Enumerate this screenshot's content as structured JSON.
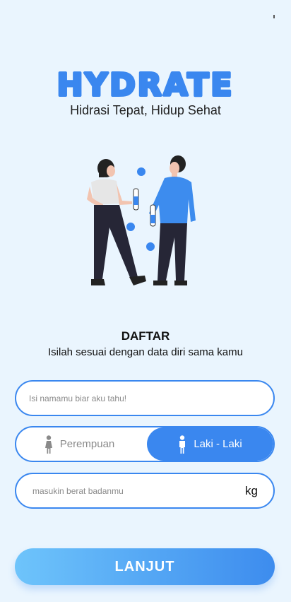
{
  "brand": {
    "logo_text": "HYDRATE",
    "tagline": "Hidrasi Tepat, Hidup Sehat"
  },
  "form": {
    "title": "DAFTAR",
    "subtitle": "Isilah sesuai dengan data diri sama kamu",
    "name_placeholder": "Isi namamu biar aku tahu!",
    "gender_options": [
      {
        "label": "Perempuan",
        "icon": "female-icon",
        "selected": false
      },
      {
        "label": "Laki - Laki",
        "icon": "male-icon",
        "selected": true
      }
    ],
    "weight_placeholder": "masukin berat badanmu",
    "weight_unit": "kg",
    "submit_label": "LANJUT"
  },
  "colors": {
    "background": "#eaf5fe",
    "accent": "#3a87ef",
    "button_gradient_start": "#6ec4fb",
    "button_gradient_end": "#3d8cee",
    "logo": "#3a87ef"
  }
}
